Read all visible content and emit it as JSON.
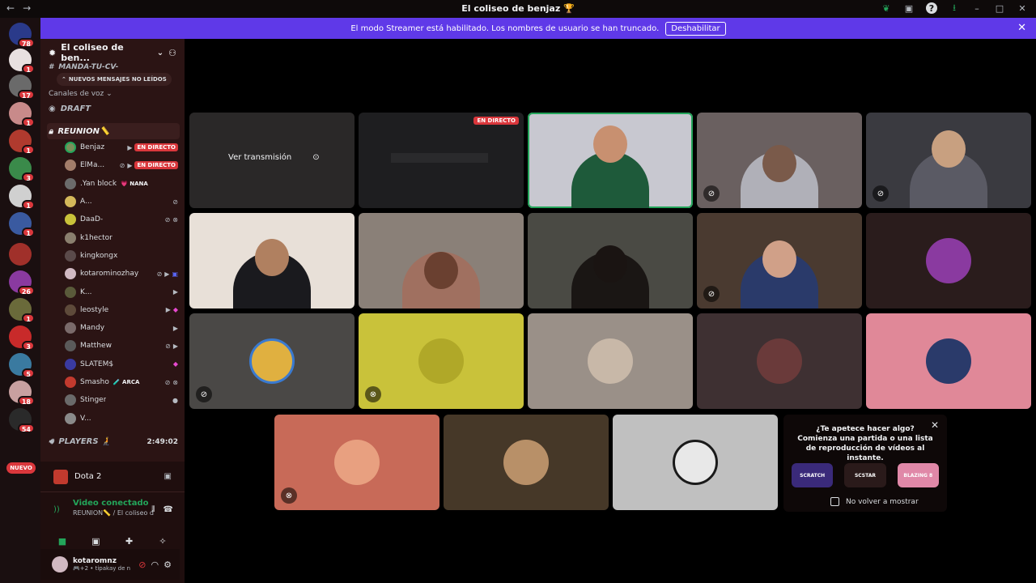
{
  "titlebar": {
    "title": "El coliseo de benjaz 🏆",
    "back": "←",
    "forward": "→"
  },
  "servers": {
    "badges": [
      "78",
      "1",
      "17",
      "1",
      "1",
      "3",
      "1",
      "1",
      "26",
      "1",
      "3",
      "5",
      "18",
      "54"
    ],
    "nuevo": "NUEVO"
  },
  "banner": {
    "text": "El modo Streamer está habilitado. Los nombres de usuario se han truncado.",
    "button": "Deshabilitar"
  },
  "sidebar": {
    "guild_name": "El coliseo de ben...",
    "cut_channel": "MANDA-TU-CV-",
    "unread_pill": "NUEVOS MENSAJES NO LEÍDOS",
    "category": "Canales de voz",
    "channels": {
      "draft": "DRAFT",
      "reunion": "REUNION📏",
      "players": "PLAYERS 🧎"
    },
    "players_time": "2:49:02",
    "voice_users": [
      {
        "name": "Benjaz",
        "live": "EN DIRECTO",
        "color": "#7a8f5a"
      },
      {
        "name": "ElMa...",
        "live": "EN DIRECTO",
        "color": "#a37d6a"
      },
      {
        "name": ".Yan block",
        "tag": "💗 NANA",
        "color": "#6b6b6b"
      },
      {
        "name": "A...",
        "color": "#d4b85a"
      },
      {
        "name": "DaaD-",
        "color": "#c9c23a"
      },
      {
        "name": "k1hector",
        "color": "#8a7f6e"
      },
      {
        "name": "kingkongx",
        "color": "#5a4a4a"
      },
      {
        "name": "kotarominozhay...",
        "color": "#d1b9c2"
      },
      {
        "name": "K...",
        "color": "#5a5a3a"
      },
      {
        "name": "leostyle",
        "color": "#5e4a3a"
      },
      {
        "name": "Mandy",
        "color": "#7a6a6a"
      },
      {
        "name": "Matthew",
        "color": "#5a5a5a"
      },
      {
        "name": "SLATEM$",
        "color": "#3a3aa0"
      },
      {
        "name": "Smasho",
        "tag": "🧪 ARCA",
        "color": "#c23a2e"
      },
      {
        "name": "Stinger",
        "color": "#6a6a6a"
      },
      {
        "name": "V...",
        "color": "#8a8a8a"
      }
    ]
  },
  "panel": {
    "game": "Dota 2",
    "voice_status": "Video conectado",
    "voice_channel": "REUNION📏 / El coliseo de be..."
  },
  "user": {
    "name": "kotaromnz",
    "status": "🎮+2 • tipakay de n"
  },
  "stage": {
    "live_badge": "EN DIRECTO",
    "watch": "Ver transmisión"
  },
  "popup": {
    "question": "¿Te apetece hacer algo?",
    "body": "Comienza una partida o una lista de reproducción de vídeos al instante.",
    "dont_show": "No volver a mostrar",
    "activities": [
      "SCRATCH",
      "SCSTAR",
      "BLAZING 8"
    ]
  },
  "colors": {
    "accent": "#5f39e8",
    "live": "#da373c",
    "connected": "#23a55a"
  }
}
